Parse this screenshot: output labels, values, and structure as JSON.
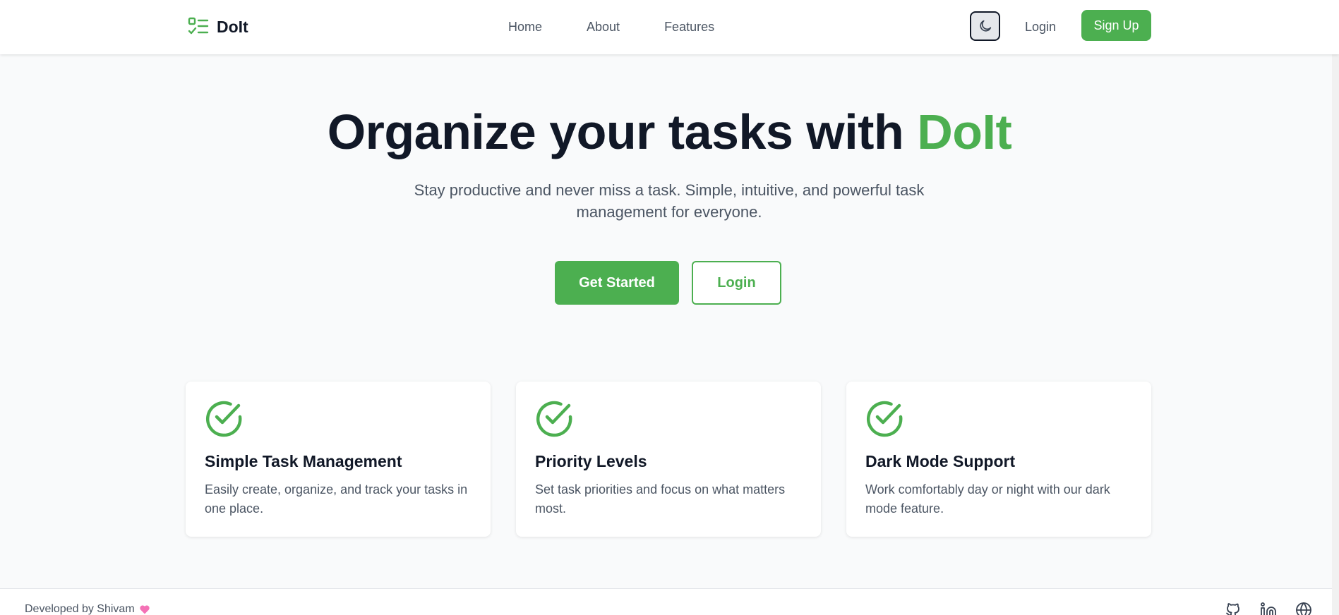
{
  "header": {
    "brand_name": "DoIt",
    "nav": [
      {
        "label": "Home"
      },
      {
        "label": "About"
      },
      {
        "label": "Features"
      }
    ],
    "theme_toggle_icon": "moon-icon",
    "login_label": "Login",
    "signup_label": "Sign Up"
  },
  "hero": {
    "title_main": "Organize your tasks with ",
    "title_accent": "DoIt",
    "subtitle": "Stay productive and never miss a task. Simple, intuitive, and powerful task management for everyone.",
    "primary_cta": "Get Started",
    "secondary_cta": "Login"
  },
  "features": [
    {
      "icon": "check-circle-icon",
      "title": "Simple Task Management",
      "description": "Easily create, organize, and track your tasks in one place."
    },
    {
      "icon": "check-circle-icon",
      "title": "Priority Levels",
      "description": "Set task priorities and focus on what matters most."
    },
    {
      "icon": "check-circle-icon",
      "title": "Dark Mode Support",
      "description": "Work comfortably day or night with our dark mode feature."
    }
  ],
  "footer": {
    "credit": "Developed by Shivam",
    "credit_icon": "heart-icon",
    "social_icons": [
      "github-icon",
      "linkedin-icon",
      "globe-icon"
    ]
  },
  "colors": {
    "accent": "#4caf50",
    "heading": "#111827",
    "body_text": "#4b5563",
    "background": "#f9fafb",
    "heart": "#f472b6"
  }
}
